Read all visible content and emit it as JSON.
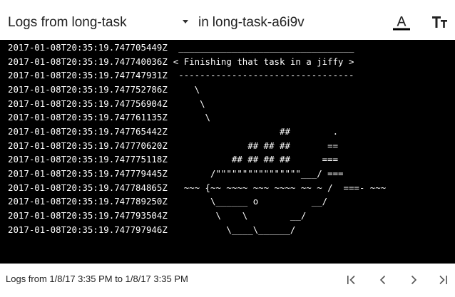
{
  "header": {
    "logs_from_prefix": "Logs from",
    "container": "long-task",
    "in_prefix": "in",
    "pod": "long-task-a6i9v",
    "icons": {
      "font_color": "text-color-icon",
      "font_size": "text-size-icon"
    }
  },
  "logs": [
    {
      "timestamp": "2017-01-08T20:35:19.747705449Z",
      "message": " _________________________________"
    },
    {
      "timestamp": "2017-01-08T20:35:19.747740036Z",
      "message": "< Finishing that task in a jiffy >"
    },
    {
      "timestamp": "2017-01-08T20:35:19.747747931Z",
      "message": " ---------------------------------"
    },
    {
      "timestamp": "2017-01-08T20:35:19.747752786Z",
      "message": "    \\"
    },
    {
      "timestamp": "2017-01-08T20:35:19.747756904Z",
      "message": "     \\"
    },
    {
      "timestamp": "2017-01-08T20:35:19.747761135Z",
      "message": "      \\"
    },
    {
      "timestamp": "2017-01-08T20:35:19.747765442Z",
      "message": "                    ##        ."
    },
    {
      "timestamp": "2017-01-08T20:35:19.747770620Z",
      "message": "              ## ## ##       =="
    },
    {
      "timestamp": "2017-01-08T20:35:19.747775118Z",
      "message": "           ## ## ## ##      ==="
    },
    {
      "timestamp": "2017-01-08T20:35:19.747779445Z",
      "message": "       /\"\"\"\"\"\"\"\"\"\"\"\"\"\"\"\"___/ ==="
    },
    {
      "timestamp": "2017-01-08T20:35:19.747784865Z",
      "message": "  ~~~ {~~ ~~~~ ~~~ ~~~~ ~~ ~ /  ===- ~~~"
    },
    {
      "timestamp": "2017-01-08T20:35:19.747789250Z",
      "message": "       \\______ o          __/"
    },
    {
      "timestamp": "2017-01-08T20:35:19.747793504Z",
      "message": "        \\    \\        __/"
    },
    {
      "timestamp": "2017-01-08T20:35:19.747797946Z",
      "message": "          \\____\\______/"
    }
  ],
  "footer": {
    "range_text": "Logs from 1/8/17 3:35 PM to 1/8/17 3:35 PM",
    "nav_icons": [
      "first-page-icon",
      "previous-page-icon",
      "next-page-icon",
      "last-page-icon"
    ]
  },
  "colors": {
    "log_background": "#000000",
    "log_text": "#ffffff",
    "text": "#212121",
    "icon": "#555555"
  }
}
